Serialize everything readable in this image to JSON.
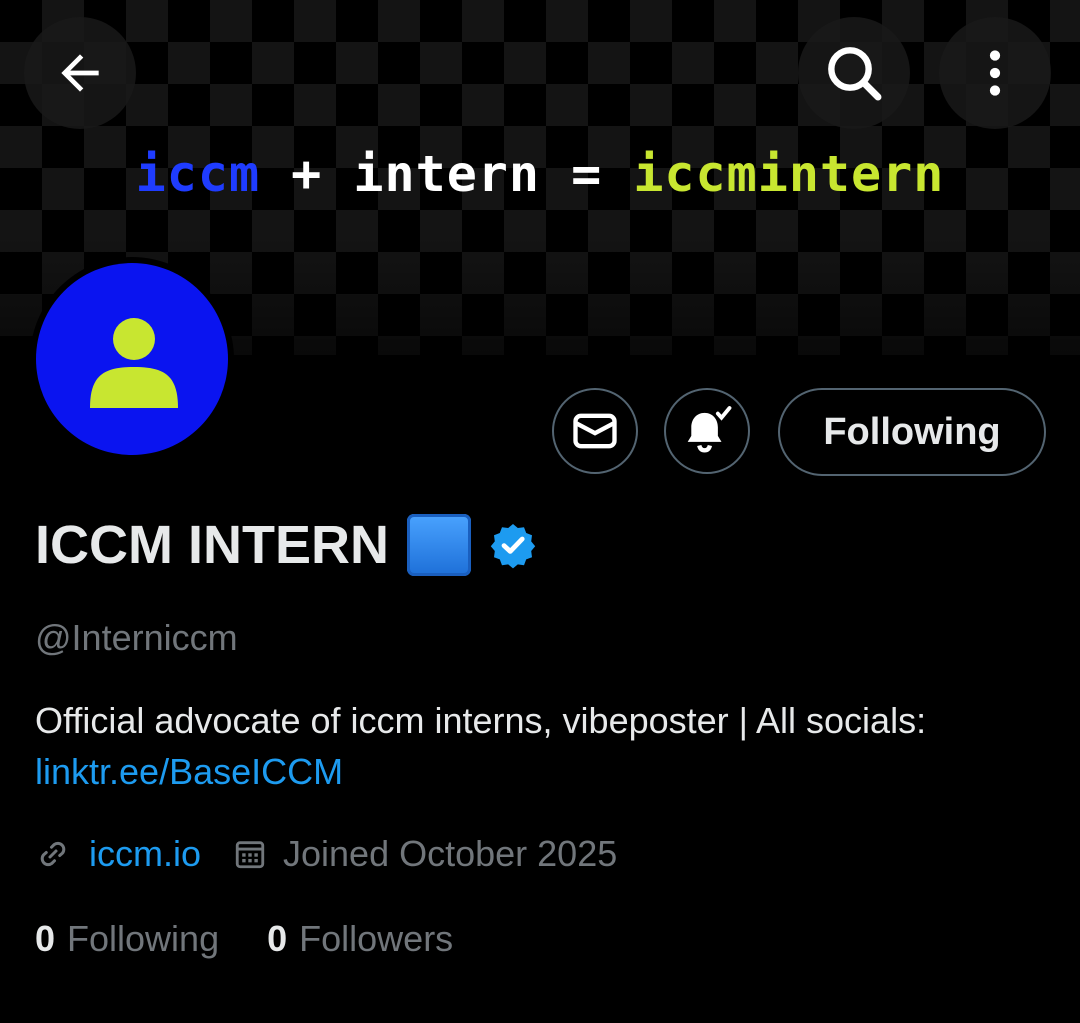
{
  "banner": {
    "tagline_parts": [
      {
        "text": "iccm",
        "color": "#1f3cff"
      },
      {
        "text": " + intern = ",
        "color": "#ffffff"
      },
      {
        "text": "iccmintern",
        "color": "#c8e630"
      }
    ]
  },
  "topbar": {
    "back_icon": "arrow-left-icon",
    "search_icon": "search-icon",
    "more_icon": "more-vertical-icon"
  },
  "avatar": {
    "background": "#0a14f0",
    "figure_color": "#c8e630",
    "icon": "person-icon"
  },
  "actions": {
    "message_icon": "mail-icon",
    "notification_icon": "bell-check-icon",
    "follow_label": "Following"
  },
  "profile": {
    "display_name": "ICCM INTERN",
    "name_emoji": "blue-square-emoji",
    "verified_icon": "verified-badge-icon",
    "verified_color": "#1d9bf0",
    "handle": "@Interniccm",
    "bio_text": "Official advocate of iccm interns, vibeposter | All socials: ",
    "bio_link": "linktr.ee/BaseICCM",
    "website": "iccm.io",
    "joined": "Joined October 2025"
  },
  "stats": {
    "following_count": "0",
    "following_label": "Following",
    "followers_count": "0",
    "followers_label": "Followers"
  },
  "colors": {
    "background": "#000000",
    "text_primary": "#e7e9ea",
    "text_secondary": "#71767b",
    "link": "#1d9bf0",
    "border": "#536471"
  }
}
